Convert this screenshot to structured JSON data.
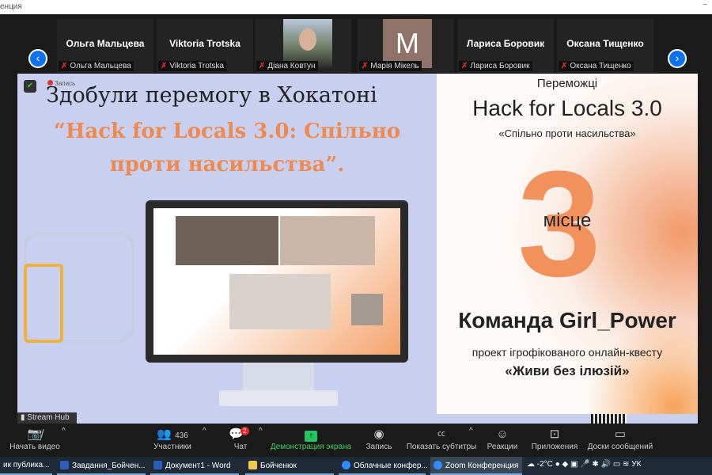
{
  "window": {
    "title": "енция",
    "minimize": "–"
  },
  "participants": [
    {
      "display": "Ольга Мальцева",
      "label": "Ольга Мальцева",
      "type": "name"
    },
    {
      "display": "Viktoria Trotska",
      "label": "Viktoria Trotska",
      "type": "name"
    },
    {
      "display": "",
      "label": "Діана Ковтун",
      "type": "photo"
    },
    {
      "display": "M",
      "label": "Марія Мікель",
      "type": "avatar"
    },
    {
      "display": "Лариса Боровик",
      "label": "Лариса Боровик",
      "type": "name"
    },
    {
      "display": "Оксана Тищенко",
      "label": "Оксана Тищенко",
      "type": "name"
    }
  ],
  "nav": {
    "prev": "‹",
    "next": "›"
  },
  "recording_label": "Запись",
  "slide": {
    "heading": "Здобули перемогу в Хокатоні",
    "subheading": "“Hack for Locals 3.0: Спільно проти насильства”.",
    "winners": "Переможці",
    "event": "Hack for Locals 3.0",
    "tagline": "«Спільно проти насильства»",
    "place_number": "3",
    "place": "місце",
    "team": "Команда Girl_Power",
    "project": "проект ігрофікованого онлайн-квесту",
    "project_name": "«Живи без ілюзій»"
  },
  "stream_hub": "Stream Hub",
  "toolbar": {
    "video": "Начать видео",
    "participants": "Участники",
    "participants_count": "436",
    "chat": "Чат",
    "chat_badge": "2",
    "share": "Демонстрация экрана",
    "record": "Запись",
    "captions": "Показать субтитры",
    "reactions": "Реакции",
    "apps": "Приложения",
    "whiteboards": "Доски сообщений"
  },
  "taskbar": {
    "items": [
      "ик публика...",
      "Завдання_Бойчен...",
      "Документ1 - Word",
      "Бойченюк",
      "Облачные конфер...",
      "Zoom Конференция"
    ],
    "temperature": "-2°C",
    "lang": "УК"
  },
  "colors": {
    "accent": "#0e72ed",
    "orange": "#ee8a4f",
    "share_green": "#22c55e"
  }
}
